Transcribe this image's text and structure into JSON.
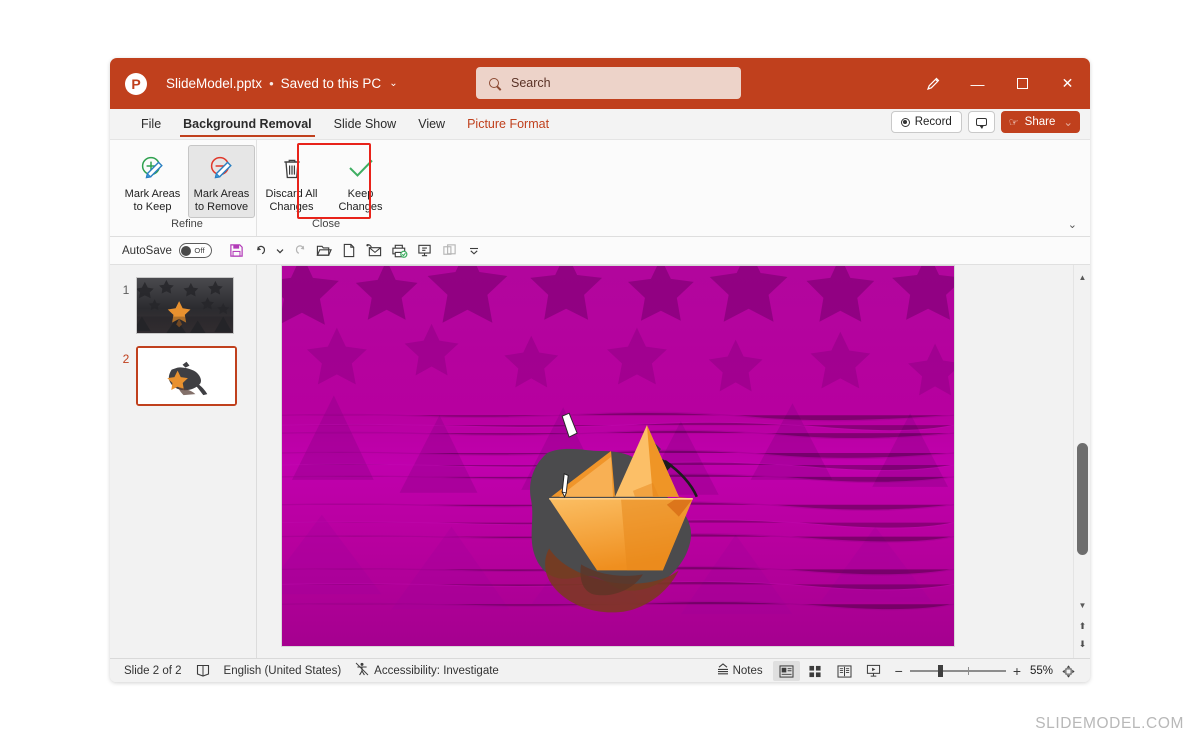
{
  "window": {
    "logo": "powerpoint-logo",
    "document_title": "SlideModel.pptx",
    "separator": "•",
    "save_state": "Saved to this PC",
    "chevron": "⌄"
  },
  "search": {
    "placeholder": "Search",
    "icon": "search-icon"
  },
  "title_buttons": {
    "pen": "✐",
    "minimize": "—",
    "maximize": "☐",
    "close": "✕"
  },
  "ribbon": {
    "tabs": [
      {
        "label": "File",
        "active": false,
        "contextual": false
      },
      {
        "label": "Background Removal",
        "active": true,
        "contextual": false
      },
      {
        "label": "Slide Show",
        "active": false,
        "contextual": false
      },
      {
        "label": "View",
        "active": false,
        "contextual": false
      },
      {
        "label": "Picture Format",
        "active": false,
        "contextual": true
      }
    ],
    "record_label": "Record",
    "comments_icon": "comment-icon",
    "share_label": "Share",
    "share_chevron": "⌄",
    "collapse_chevron": "⌄",
    "groups": [
      {
        "name": "Refine",
        "label": "Refine",
        "buttons": [
          {
            "id": "mark-areas-to-keep",
            "label": "Mark Areas\nto Keep",
            "icon": "mark-keep-icon",
            "pressed": false
          },
          {
            "id": "mark-areas-to-remove",
            "label": "Mark Areas\nto Remove",
            "icon": "mark-remove-icon",
            "pressed": true
          }
        ]
      },
      {
        "name": "Close",
        "label": "Close",
        "buttons": [
          {
            "id": "discard-all-changes",
            "label": "Discard All\nChanges",
            "icon": "trash-icon",
            "pressed": false
          },
          {
            "id": "keep-changes",
            "label": "Keep\nChanges",
            "icon": "checkmark-icon",
            "pressed": false
          }
        ]
      }
    ]
  },
  "quick_access": {
    "autosave_label": "AutoSave",
    "autosave_state": "Off",
    "buttons": [
      {
        "id": "save",
        "icon": "save-icon"
      },
      {
        "id": "undo",
        "icon": "undo-icon"
      },
      {
        "id": "undo-dropdown",
        "icon": "chevron-down-icon"
      },
      {
        "id": "redo",
        "icon": "redo-icon"
      },
      {
        "id": "open",
        "icon": "open-folder-icon"
      },
      {
        "id": "new",
        "icon": "new-file-icon"
      },
      {
        "id": "email",
        "icon": "email-icon"
      },
      {
        "id": "print-preview",
        "icon": "print-icon"
      },
      {
        "id": "start-presentation",
        "icon": "present-icon"
      },
      {
        "id": "duplicate",
        "icon": "duplicate-icon"
      },
      {
        "id": "customize-qat",
        "icon": "more-chevron-icon"
      }
    ]
  },
  "thumbnails": [
    {
      "number": "1",
      "selected": false
    },
    {
      "number": "2",
      "selected": true
    }
  ],
  "status_bar": {
    "slide_indicator": "Slide 2 of 2",
    "notes_icon": "notes-page-icon",
    "language": "English (United States)",
    "accessibility_icon": "accessibility-icon",
    "accessibility": "Accessibility: Investigate",
    "notes_label": "Notes",
    "views": [
      {
        "id": "normal-view",
        "icon": "normal-view-icon",
        "active": true
      },
      {
        "id": "slide-sorter-view",
        "icon": "slide-sorter-icon",
        "active": false
      },
      {
        "id": "reading-view",
        "icon": "reading-view-icon",
        "active": false
      },
      {
        "id": "slide-show-view",
        "icon": "slide-show-icon",
        "active": false
      }
    ],
    "zoom_out": "−",
    "zoom_in": "+",
    "zoom_level": "55%",
    "fit_icon": "fit-to-window-icon"
  },
  "canvas": {
    "description": "Background removal preview: magenta-tinted low-poly star background with orange origami boat",
    "background_base_color": "#b5009e",
    "background_shape_color": "#7d0073",
    "removal_tint_color": "#c400c4",
    "boat_color": "#f5a13a",
    "boat_shadow_color": "#4a4a4a",
    "cursor_icon": "pencil-cursor"
  },
  "watermark": "SLIDEMODEL.COM",
  "colors": {
    "brand": "#c0401d",
    "highlight": "#e8231a",
    "window_chrome": "#f3f3f3",
    "ribbon": "#fbfbfb"
  }
}
